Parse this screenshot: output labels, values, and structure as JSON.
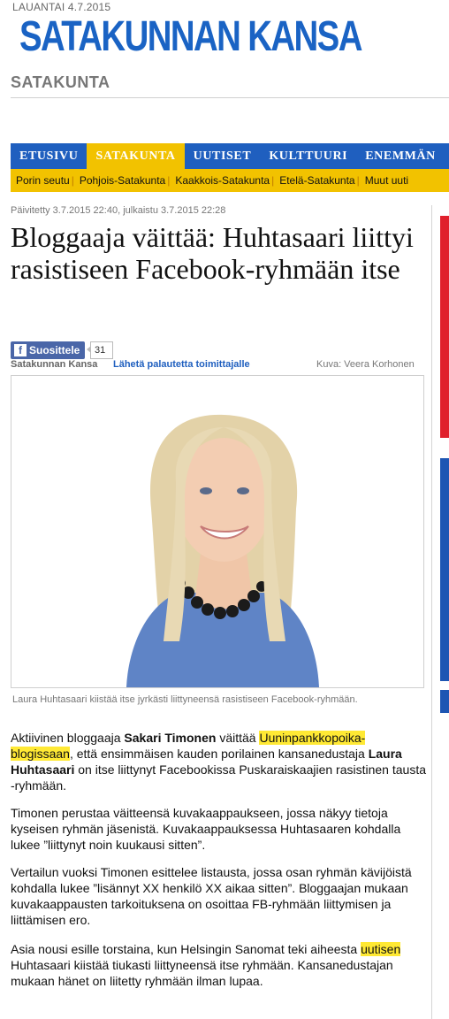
{
  "header": {
    "date": "LAUANTAI 4.7.2015",
    "brand": "SATAKUNNAN KANSA",
    "section": "SATAKUNTA"
  },
  "nav": {
    "items": [
      {
        "label": "ETUSIVU",
        "active": false
      },
      {
        "label": "SATAKUNTA",
        "active": true
      },
      {
        "label": "UUTISET",
        "active": false
      },
      {
        "label": "KULTTUURI",
        "active": false
      },
      {
        "label": "ENEMMÄN",
        "active": false
      }
    ],
    "subitems": [
      "Porin seutu",
      "Pohjois-Satakunta",
      "Kaakkois-Satakunta",
      "Etelä-Satakunta",
      "Muut uuti"
    ]
  },
  "article": {
    "updated": "Päivitetty 3.7.2015 22:40, julkaistu 3.7.2015 22:28",
    "headline": "Bloggaaja väittää: Huhtasaari liittyi rasistiseen Facebook-ryhmään itse",
    "like_label": "Suosittele",
    "like_count": "31",
    "source": "Satakunnan Kansa",
    "feedback_link": "Lähetä palautetta toimittajalle",
    "photo_credit": "Kuva: Veera Korhonen",
    "caption": "Laura Huhtasaari kiistää itse jyrkästi liittyneensä rasistiseen Facebook-ryhmään.",
    "p1": {
      "a": "Aktiivinen bloggaaja ",
      "b": "Sakari Timonen",
      "c": " väittää ",
      "link": "Uuninpankkopoika-blogissaan",
      "d": ", että ensimmäisen kauden porilainen kansanedustaja ",
      "e": "Laura Huhtasaari",
      "f": " on itse liittynyt Facebookissa Puskaraiskaajien rasistinen tausta -ryhmään."
    },
    "p2": "Timonen perustaa väitteensä kuvakaappaukseen, jossa näkyy tietoja kyseisen ryhmän jäsenistä. Kuvakaappauksessa Huhtasaaren kohdalla lukee ”liittynyt noin kuukausi sitten”.",
    "p3": "Vertailun vuoksi Timonen esittelee listausta, jossa osan ryhmän kävijöistä kohdalla lukee ”lisännyt XX henkilö XX aikaa sitten”. Bloggaajan mukaan kuvakaappausten tarkoituksena on osoittaa FB-ryhmään liittymisen ja liittämisen ero.",
    "p4": {
      "a": "Asia nousi esille torstaina, kun Helsingin Sanomat teki aiheesta ",
      "link": "uutisen",
      "b": " Huhtasaari kiistää tiukasti liittyneensä itse ryhmään. Kansanedustajan mukaan hänet on liitetty ryhmään ilman lupaa."
    }
  },
  "colors": {
    "brand_blue": "#1a63c4",
    "nav_blue": "#1f5fbf",
    "accent_yellow": "#f2c200",
    "highlight_yellow": "#ffe934",
    "facebook_blue": "#4a66a8"
  }
}
